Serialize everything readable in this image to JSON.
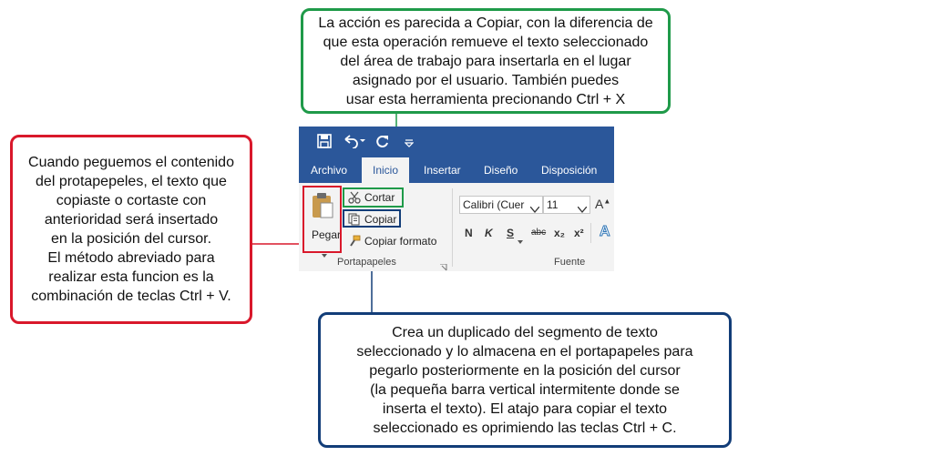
{
  "callouts": {
    "cut": {
      "lines": [
        "La acción es parecida a Copiar, con la diferencia de",
        "que esta operación remueve el texto seleccionado",
        "del área de trabajo para insertarla en el lugar",
        "asignado por el usuario. También puedes",
        "usar esta herramienta precionando Ctrl + X"
      ],
      "color": "#1f9a49"
    },
    "paste": {
      "lines": [
        "Cuando peguemos el contenido",
        "del protapepeles, el texto que",
        "copiaste o cortaste con",
        "anterioridad será insertado",
        "en la posición del cursor.",
        "El método abreviado para",
        "realizar esta funcion es la",
        "combinación de teclas Ctrl + V."
      ],
      "color": "#d9182b"
    },
    "copy": {
      "lines": [
        "Crea un duplicado del segmento de texto",
        "seleccionado y lo almacena en el portapapeles para",
        "pegarlo posteriormente en la posición del cursor",
        "(la pequeña barra vertical intermitente donde se",
        "inserta el texto). El atajo para copiar el texto",
        "seleccionado es oprimiendo las teclas Ctrl + C."
      ],
      "color": "#123d78"
    }
  },
  "ribbon": {
    "tabs": [
      "Archivo",
      "Inicio",
      "Insertar",
      "Diseño",
      "Disposición"
    ],
    "clipboard": {
      "paste": "Pegar",
      "cut": "Cortar",
      "copy": "Copiar",
      "format_painter": "Copiar formato",
      "group_label": "Portapapeles"
    },
    "font": {
      "font_name": "Calibri (Cuer",
      "font_size": "11",
      "bold": "N",
      "italic": "K",
      "underline": "S",
      "strikethrough": "abc",
      "subscript": "x₂",
      "superscript": "x²",
      "group_label": "Fuente"
    }
  },
  "colors": {
    "ribbon_blue": "#2b579a"
  }
}
